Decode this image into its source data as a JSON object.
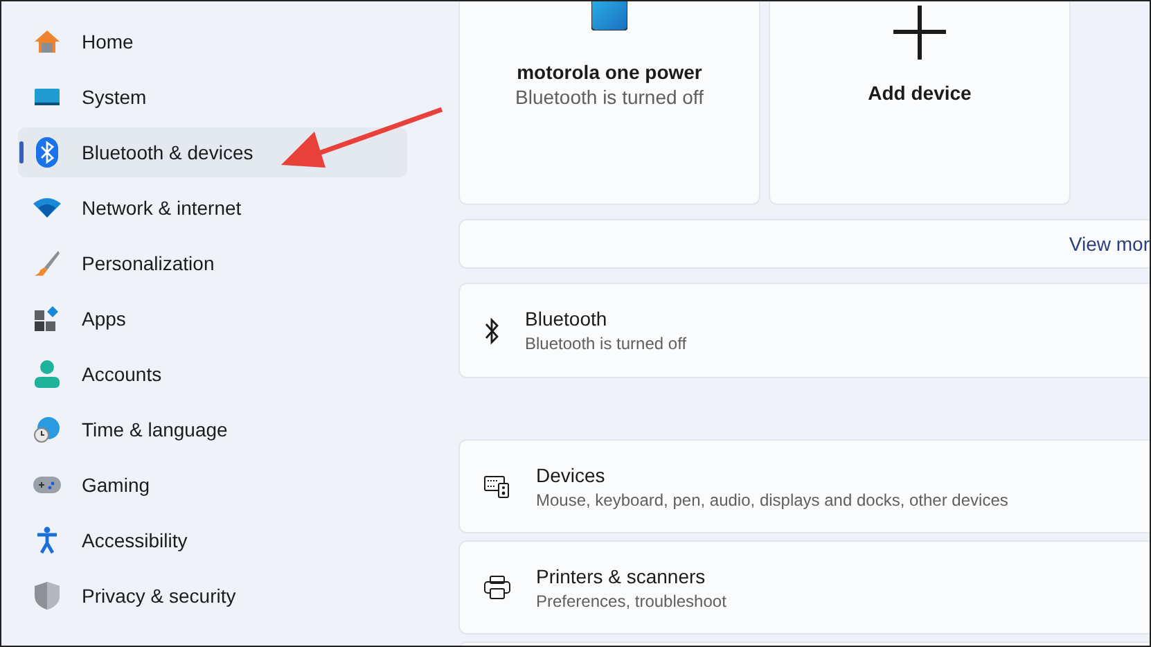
{
  "sidebar": {
    "items": [
      {
        "label": "Home",
        "selected": false
      },
      {
        "label": "System",
        "selected": false
      },
      {
        "label": "Bluetooth & devices",
        "selected": true
      },
      {
        "label": "Network & internet",
        "selected": false
      },
      {
        "label": "Personalization",
        "selected": false
      },
      {
        "label": "Apps",
        "selected": false
      },
      {
        "label": "Accounts",
        "selected": false
      },
      {
        "label": "Time & language",
        "selected": false
      },
      {
        "label": "Gaming",
        "selected": false
      },
      {
        "label": "Accessibility",
        "selected": false
      },
      {
        "label": "Privacy & security",
        "selected": false
      }
    ]
  },
  "device_cards": [
    {
      "kind": "device",
      "name": "motorola one power",
      "status": "Bluetooth is turned off"
    },
    {
      "kind": "add",
      "name": "Add device"
    }
  ],
  "view_more": {
    "label": "View mor"
  },
  "bluetooth_row": {
    "title": "Bluetooth",
    "subtitle": "Bluetooth is turned off"
  },
  "settings_rows": [
    {
      "title": "Devices",
      "subtitle": "Mouse, keyboard, pen, audio, displays and docks, other devices"
    },
    {
      "title": "Printers & scanners",
      "subtitle": "Preferences, troubleshoot"
    }
  ]
}
